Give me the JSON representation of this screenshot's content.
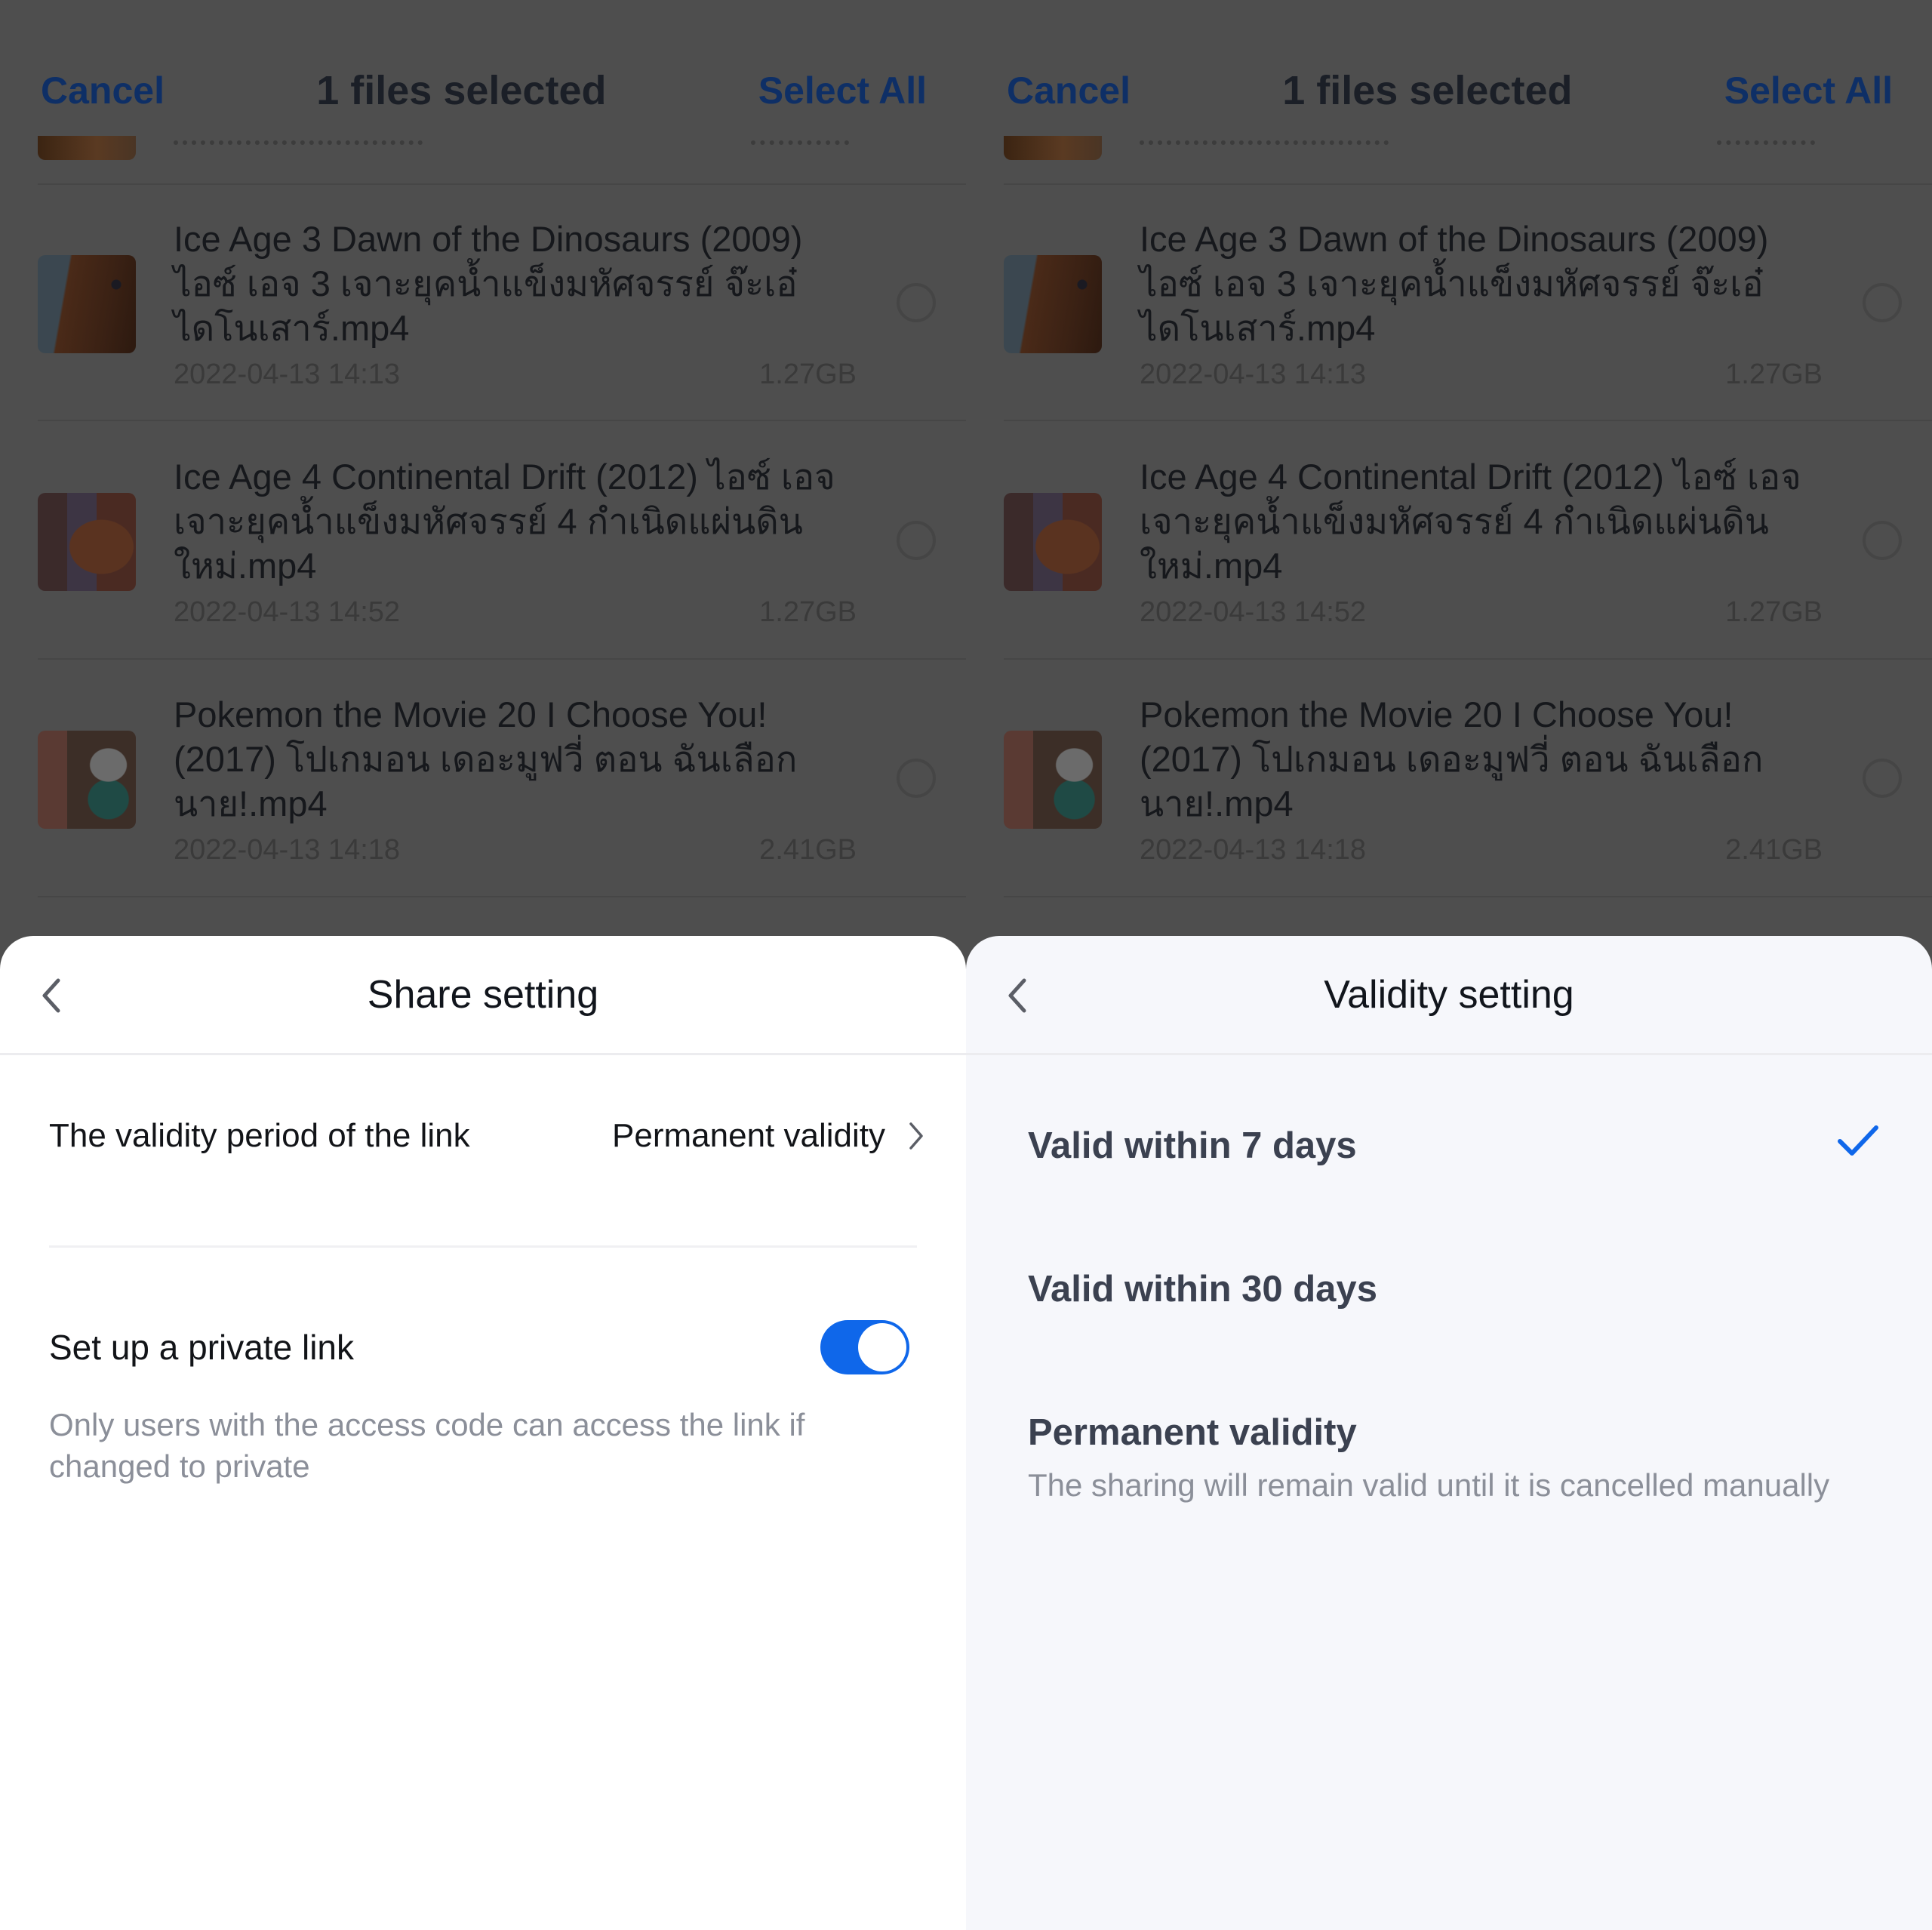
{
  "colors": {
    "accent": "#0f67ea",
    "overlay_bg": "#4e4e4e",
    "link_dimmed": "#0e2f66",
    "share_sheet_bg": "#ffffff",
    "validity_sheet_bg": "#f6f7fb"
  },
  "screens": [
    {
      "background": {
        "topbar": {
          "cancel_label": "Cancel",
          "title": "1 files selected",
          "select_all_label": "Select All"
        },
        "files": [
          {
            "name": "Ice Age 3 Dawn of the Dinosaurs (2009) ไอซ์ เอจ 3 เจาะยุคน้ำแข็งมหัศจรรย์ จ๊ะเอ๋ไดโนเสาร์.mp4",
            "date": "2022-04-13 14:13",
            "size": "1.27GB",
            "selected": false
          },
          {
            "name": "Ice Age 4 Continental Drift (2012) ไอซ์ เอจ เจาะยุคน้ำแข็งมหัศจรรย์ 4 กำเนิดแผ่นดินใหม่.mp4",
            "date": "2022-04-13 14:52",
            "size": "1.27GB",
            "selected": false
          },
          {
            "name": "Pokemon the Movie 20 I Choose You! (2017) โปเกมอน เดอะมูฟวี่ ตอน ฉันเลือกนาย!.mp4",
            "date": "2022-04-13 14:18",
            "size": "2.41GB",
            "selected": false
          }
        ]
      },
      "sheet": {
        "back_icon": "chevron-left-icon",
        "title": "Share setting",
        "validity_row": {
          "label": "The validity period of the link",
          "value": "Permanent validity",
          "chevron_icon": "chevron-right-icon"
        },
        "private_link": {
          "label": "Set up a private link",
          "enabled": true,
          "hint": "Only users with the access code can access the link if changed to private"
        }
      }
    },
    {
      "background": {
        "topbar": {
          "cancel_label": "Cancel",
          "title": "1 files selected",
          "select_all_label": "Select All"
        },
        "files": [
          {
            "name": "Ice Age 3 Dawn of the Dinosaurs (2009) ไอซ์ เอจ 3 เจาะยุคน้ำแข็งมหัศจรรย์ จ๊ะเอ๋ไดโนเสาร์.mp4",
            "date": "2022-04-13 14:13",
            "size": "1.27GB",
            "selected": false
          },
          {
            "name": "Ice Age 4 Continental Drift (2012) ไอซ์ เอจ เจาะยุคน้ำแข็งมหัศจรรย์ 4 กำเนิดแผ่นดินใหม่.mp4",
            "date": "2022-04-13 14:52",
            "size": "1.27GB",
            "selected": false
          },
          {
            "name": "Pokemon the Movie 20 I Choose You! (2017) โปเกมอน เดอะมูฟวี่ ตอน ฉันเลือกนาย!.mp4",
            "date": "2022-04-13 14:18",
            "size": "2.41GB",
            "selected": false
          }
        ]
      },
      "sheet": {
        "back_icon": "chevron-left-icon",
        "title": "Validity setting",
        "options": [
          {
            "label": "Valid within 7 days",
            "description": "",
            "selected": true
          },
          {
            "label": "Valid within 30 days",
            "description": "",
            "selected": false
          },
          {
            "label": "Permanent validity",
            "description": "The sharing will remain valid until it is cancelled manually",
            "selected": false
          }
        ]
      }
    }
  ]
}
